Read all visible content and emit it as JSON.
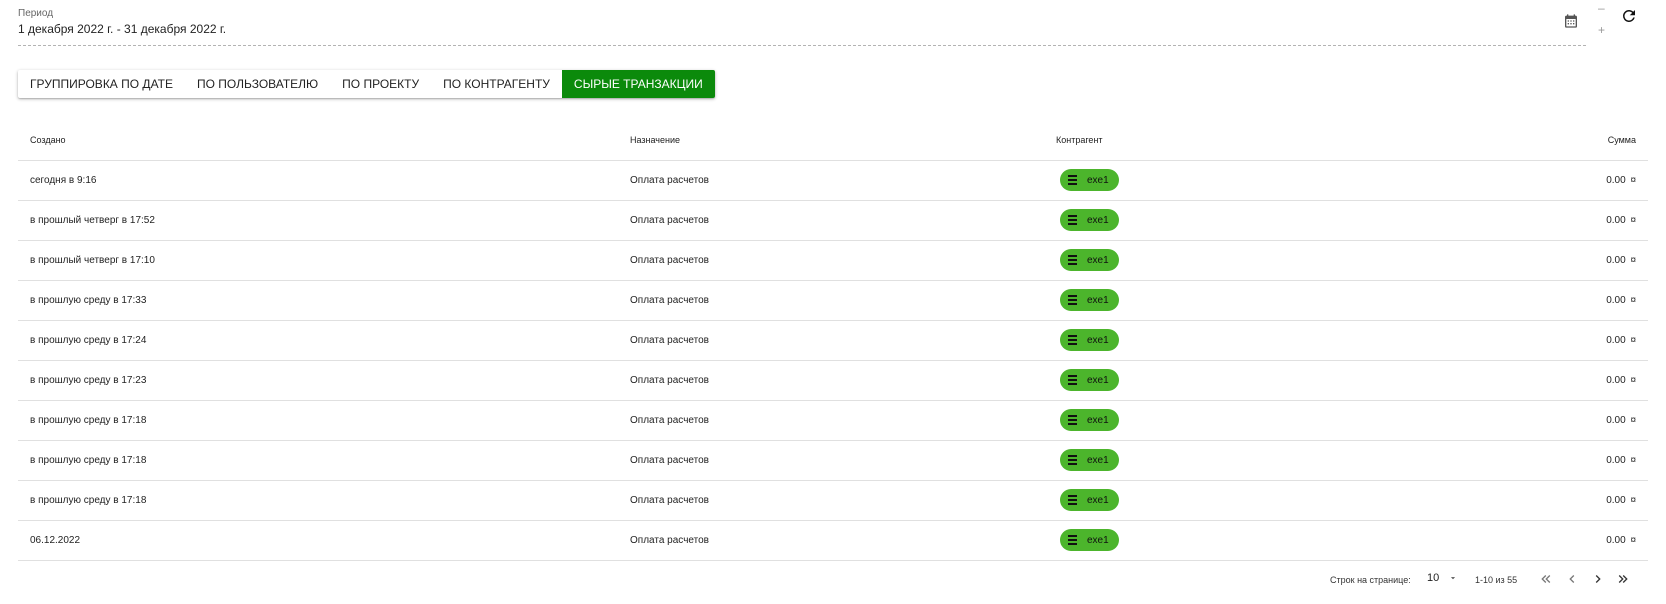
{
  "period": {
    "label": "Период",
    "value": "1 декабря 2022 г. - 31 декабря 2022 г."
  },
  "controls": {
    "zoom_minus": "–",
    "zoom_plus": "+"
  },
  "tabs": [
    {
      "label": "Группировка по дате",
      "active": false
    },
    {
      "label": "По пользователю",
      "active": false
    },
    {
      "label": "По проекту",
      "active": false
    },
    {
      "label": "По контрагенту",
      "active": false
    },
    {
      "label": "Сырые транзакции",
      "active": true
    }
  ],
  "table": {
    "headers": {
      "created": "Создано",
      "purpose": "Назначение",
      "counterparty": "Контрагент",
      "sum": "Сумма"
    },
    "rows": [
      {
        "created": "сегодня в 9:16",
        "purpose": "Оплата расчетов",
        "counterparty": "exe1",
        "sum": "0.00",
        "currency": "¤"
      },
      {
        "created": "в прошлый четверг в 17:52",
        "purpose": "Оплата расчетов",
        "counterparty": "exe1",
        "sum": "0.00",
        "currency": "¤"
      },
      {
        "created": "в прошлый четверг в 17:10",
        "purpose": "Оплата расчетов",
        "counterparty": "exe1",
        "sum": "0.00",
        "currency": "¤"
      },
      {
        "created": "в прошлую среду в 17:33",
        "purpose": "Оплата расчетов",
        "counterparty": "exe1",
        "sum": "0.00",
        "currency": "¤"
      },
      {
        "created": "в прошлую среду в 17:24",
        "purpose": "Оплата расчетов",
        "counterparty": "exe1",
        "sum": "0.00",
        "currency": "¤"
      },
      {
        "created": "в прошлую среду в 17:23",
        "purpose": "Оплата расчетов",
        "counterparty": "exe1",
        "sum": "0.00",
        "currency": "¤"
      },
      {
        "created": "в прошлую среду в 17:18",
        "purpose": "Оплата расчетов",
        "counterparty": "exe1",
        "sum": "0.00",
        "currency": "¤"
      },
      {
        "created": "в прошлую среду в 17:18",
        "purpose": "Оплата расчетов",
        "counterparty": "exe1",
        "sum": "0.00",
        "currency": "¤"
      },
      {
        "created": "в прошлую среду в 17:18",
        "purpose": "Оплата расчетов",
        "counterparty": "exe1",
        "sum": "0.00",
        "currency": "¤"
      },
      {
        "created": "06.12.2022",
        "purpose": "Оплата расчетов",
        "counterparty": "exe1",
        "sum": "0.00",
        "currency": "¤"
      }
    ]
  },
  "pagination": {
    "rows_per_page_label": "Строк на странице:",
    "rows_per_page_value": "10",
    "range": "1-10 из 55"
  },
  "colors": {
    "active_tab": "#0b8a0b",
    "chip": "#4cb52c"
  },
  "icons": [
    "calendar-icon",
    "refresh-icon",
    "database-icon",
    "chevron-down-icon",
    "first-page-icon",
    "prev-page-icon",
    "next-page-icon",
    "last-page-icon"
  ]
}
